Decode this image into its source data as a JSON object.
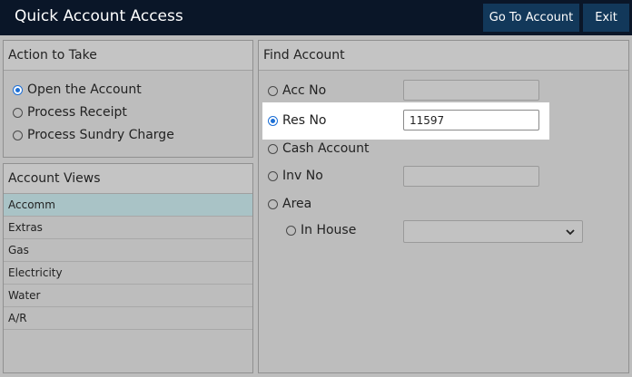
{
  "header": {
    "title": "Quick Account Access",
    "go_to_account": "Go To Account",
    "exit": "Exit"
  },
  "action_panel": {
    "title": "Action to Take",
    "options": [
      {
        "label": "Open the Account",
        "checked": true
      },
      {
        "label": "Process Receipt",
        "checked": false
      },
      {
        "label": "Process Sundry Charge",
        "checked": false
      }
    ]
  },
  "views_panel": {
    "title": "Account Views",
    "items": [
      "Accomm",
      "Extras",
      "Gas",
      "Electricity",
      "Water",
      "A/R"
    ],
    "selected": "Accomm"
  },
  "find_panel": {
    "title": "Find Account",
    "acc_no": {
      "label": "Acc No",
      "value": ""
    },
    "res_no": {
      "label": "Res No",
      "value": "11597"
    },
    "cash_account": {
      "label": "Cash Account"
    },
    "inv_no": {
      "label": "Inv No",
      "value": ""
    },
    "area": {
      "label": "Area"
    },
    "in_house": {
      "label": "In House",
      "value": ""
    }
  },
  "colors": {
    "titlebar": "#0a1628",
    "button": "#12385a",
    "radio_checked": "#1c6fd6",
    "selected_row": "#a9c3c6"
  },
  "icons": {
    "dropdown": "chevron-down-icon"
  }
}
